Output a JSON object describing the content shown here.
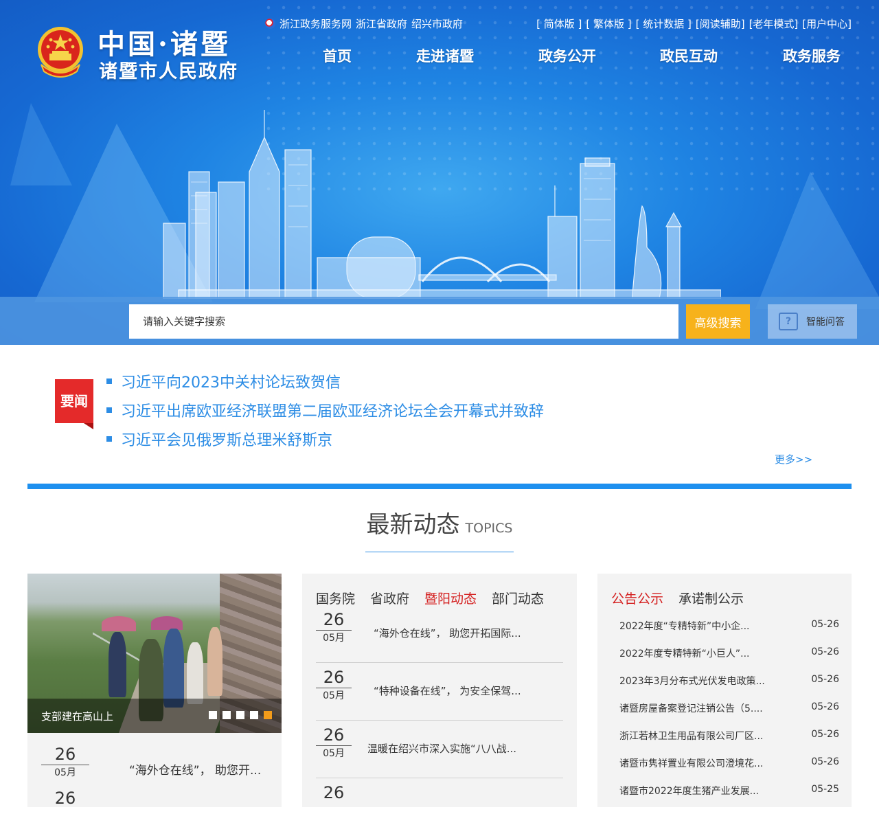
{
  "header": {
    "logo_line1": "中国·诸暨",
    "logo_line2": "诸暨市人民政府",
    "left_links": [
      "浙江政务服务网",
      "浙江省政府",
      "绍兴市政府"
    ],
    "right_links": [
      "[ 简体版 ]",
      "[ 繁体版 ]",
      "[ 统计数据 ]",
      "[阅读辅助]",
      "[老年模式]",
      "[用户中心]"
    ],
    "nav": [
      "首页",
      "走进诸暨",
      "政务公开",
      "政民互动",
      "政务服务"
    ]
  },
  "search": {
    "placeholder": "请输入关键字搜索",
    "advanced_label": "高级搜索",
    "qa_label": "智能问答"
  },
  "headlines": {
    "badge": "要闻",
    "items": [
      "习近平向2023中关村论坛致贺信",
      "习近平出席欧亚经济联盟第二届欧亚经济论坛全会开幕式并致辞",
      "习近平会见俄罗斯总理米舒斯京"
    ],
    "more": "更多>>"
  },
  "section": {
    "title_cn": "最新动态",
    "title_en": "TOPICS"
  },
  "slider": {
    "caption": "支部建在高山上",
    "active_dot": 4,
    "dot_count": 5
  },
  "left_news": [
    {
      "day": "26",
      "month": "05月",
      "title": "“海外仓在线”， 助您开..."
    },
    {
      "day": "26"
    }
  ],
  "middle": {
    "tabs": [
      "国务院",
      "省政府",
      "暨阳动态",
      "部门动态"
    ],
    "active_tab": 2,
    "items": [
      {
        "day": "26",
        "month": "05月",
        "title": "“海外仓在线”， 助您开拓国际..."
      },
      {
        "day": "26",
        "month": "05月",
        "title": "“特种设备在线”， 为安全保驾..."
      },
      {
        "day": "26",
        "month": "05月",
        "title": "温暖在绍兴市深入实施“八八战..."
      },
      {
        "day": "26"
      }
    ]
  },
  "right": {
    "tabs": [
      "公告公示",
      "承诺制公示"
    ],
    "active_tab": 0,
    "items": [
      {
        "title": "2022年度“专精特新”中小企...",
        "date": "05-26"
      },
      {
        "title": "2022年度专精特新“小巨人”...",
        "date": "05-26"
      },
      {
        "title": "2023年3月分布式光伏发电政策...",
        "date": "05-26"
      },
      {
        "title": "诸暨房屋备案登记注销公告（5....",
        "date": "05-26"
      },
      {
        "title": "浙江若林卫生用品有限公司厂区...",
        "date": "05-26"
      },
      {
        "title": "诸暨市隽祥置业有限公司澄境花...",
        "date": "05-26"
      },
      {
        "title": "诸暨市2022年度生猪产业发展...",
        "date": "05-25"
      }
    ]
  },
  "colors": {
    "primary_blue": "#1e90ef",
    "accent_red": "#d42020",
    "accent_orange": "#f7b21b"
  }
}
